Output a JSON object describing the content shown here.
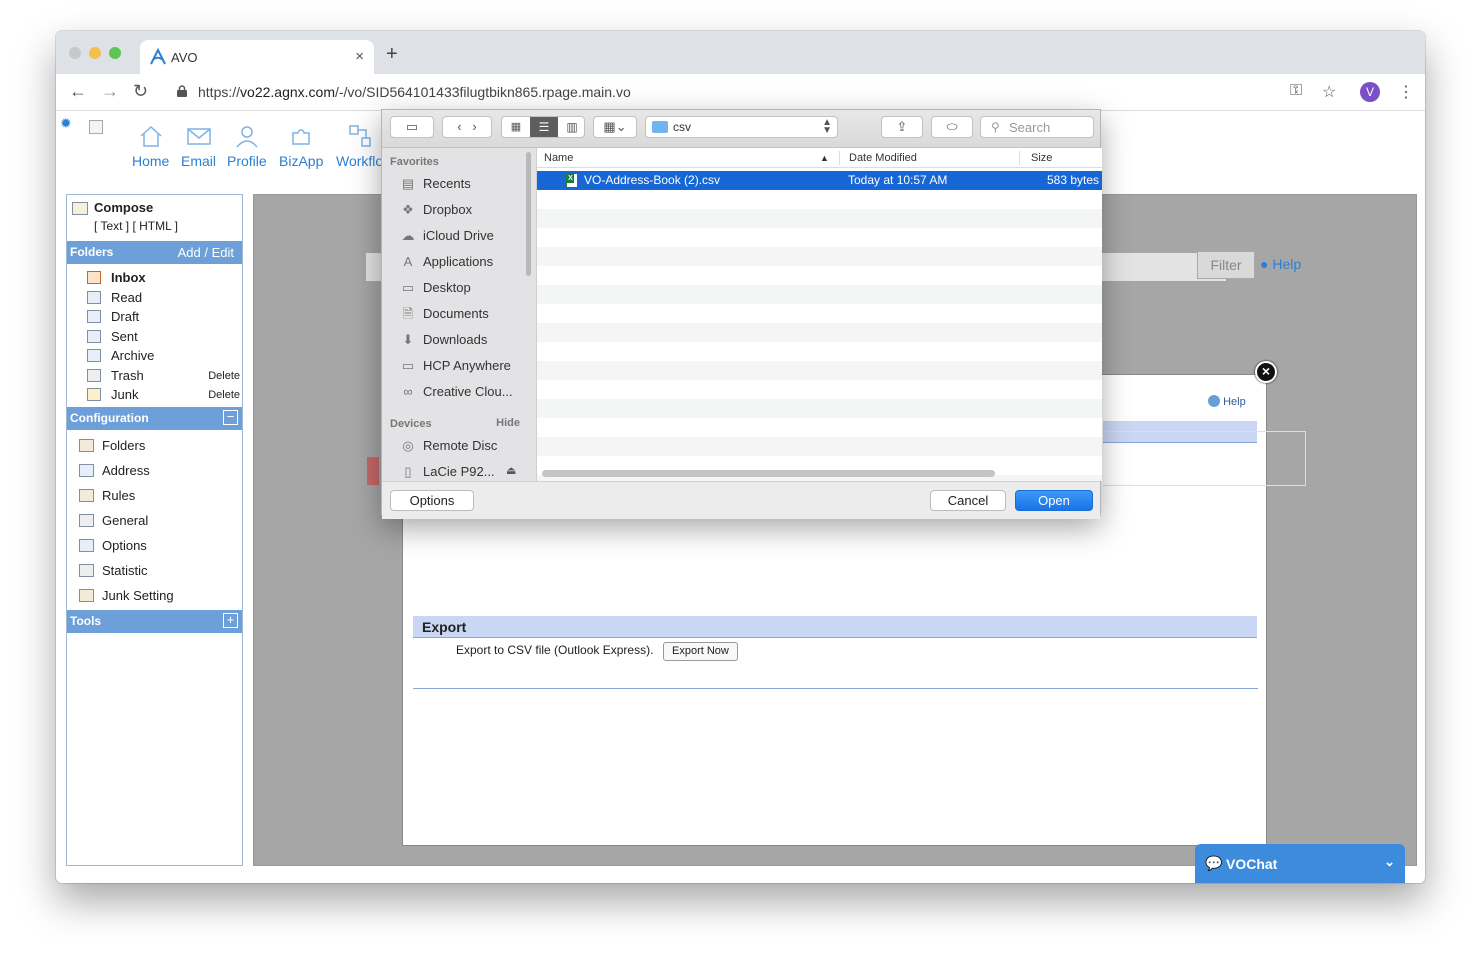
{
  "browser": {
    "tab_title": "AVO",
    "tab_close": "×",
    "new_tab": "+",
    "url_prefix": "https://",
    "url_host": "vo22.agnx.com",
    "url_path": "/-/vo/SID564101433filugtbikn865.rpage.main.vo",
    "avatar_letter": "V"
  },
  "topnav": [
    "Home",
    "Email",
    "Profile",
    "BizApp",
    "Workflo"
  ],
  "left": {
    "compose_label": "Compose",
    "compose_sub": "[ Text ] [ HTML ]",
    "folders_header": "Folders",
    "folders_action": "Add / Edit",
    "folders": [
      {
        "label": "Inbox"
      },
      {
        "label": "Read"
      },
      {
        "label": "Draft"
      },
      {
        "label": "Sent"
      },
      {
        "label": "Archive"
      },
      {
        "label": "Trash",
        "action": "Delete"
      },
      {
        "label": "Junk",
        "action": "Delete"
      }
    ],
    "config_header": "Configuration",
    "config_toggle": "−",
    "config_items": [
      "Folders",
      "Address",
      "Rules",
      "General",
      "Options",
      "Statistic",
      "Junk Setting"
    ],
    "tools_header": "Tools",
    "tools_toggle": "+"
  },
  "main": {
    "filter_label": "Filter",
    "help_label": "Help"
  },
  "modal": {
    "close": "×",
    "help": "Help",
    "export_title": "Export",
    "export_text": "Export to CSV file (Outlook Express).",
    "export_button": "Export Now"
  },
  "chat": {
    "label": "VOChat"
  },
  "dialog": {
    "path": "csv",
    "search_placeholder": "Search",
    "favorites_header": "Favorites",
    "favorites": [
      "Recents",
      "Dropbox",
      "iCloud Drive",
      "Applications",
      "Desktop",
      "Documents",
      "Downloads",
      "HCP Anywhere",
      "Creative Clou..."
    ],
    "devices_header": "Devices",
    "devices_hide": "Hide",
    "devices": [
      "Remote Disc",
      "LaCie P92..."
    ],
    "columns": {
      "name": "Name",
      "modified": "Date Modified",
      "size": "Size"
    },
    "files": [
      {
        "name": "VO-Address-Book (2).csv",
        "modified": "Today at 10:57 AM",
        "size": "583 bytes"
      }
    ],
    "options_button": "Options",
    "cancel_button": "Cancel",
    "open_button": "Open"
  }
}
